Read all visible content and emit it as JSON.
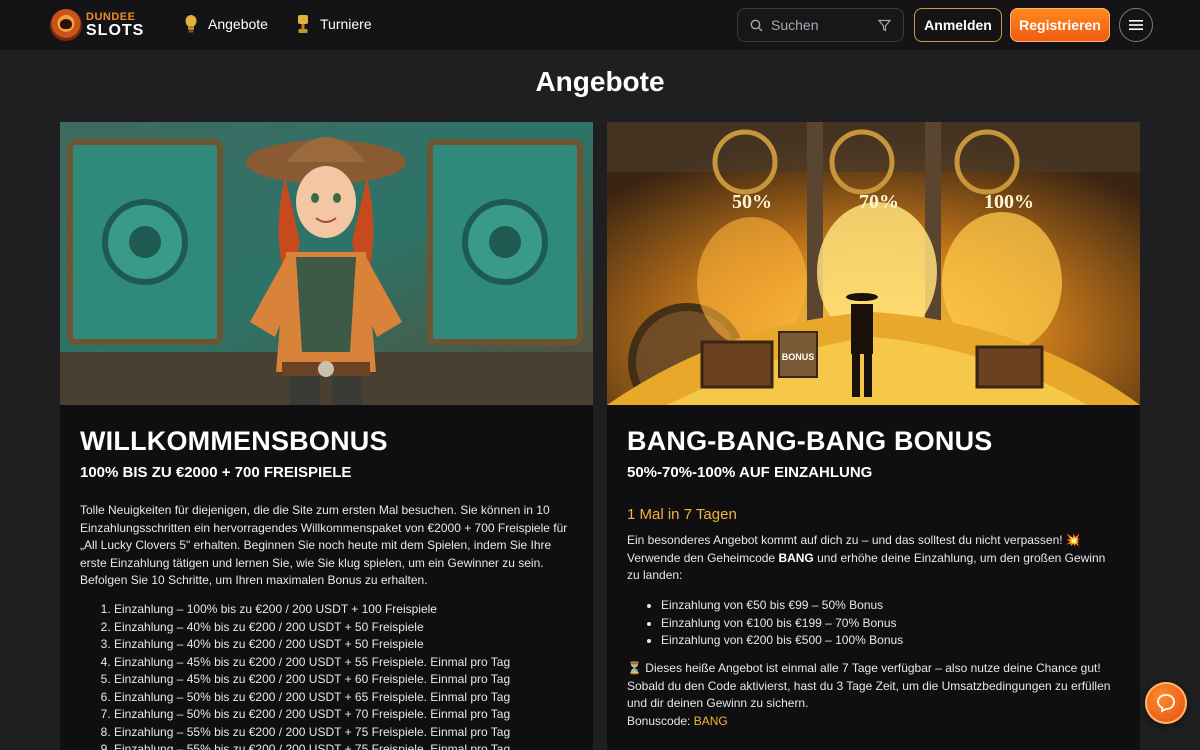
{
  "header": {
    "logo_line1": "DUNDEE",
    "logo_line2": "SLOTS",
    "nav": [
      {
        "label": "Angebote",
        "icon": "lightbulb-icon"
      },
      {
        "label": "Turniere",
        "icon": "trophy-icon"
      }
    ],
    "search_placeholder": "Suchen",
    "login_label": "Anmelden",
    "register_label": "Registrieren"
  },
  "page_title": "Angebote",
  "cards": [
    {
      "title": "WILLKOMMENSBONUS",
      "subtitle": "100% BIS ZU €2000 + 700 FREISPIELE",
      "intro": "Tolle Neuigkeiten für diejenigen, die die Site zum ersten Mal besuchen. Sie können in 10 Einzahlungsschritten ein hervorragendes Willkommenspaket von €2000 + 700 Freispiele für „All Lucky Clovers 5\" erhalten. Beginnen Sie noch heute mit dem Spielen, indem Sie Ihre erste Einzahlung tätigen und lernen Sie, wie Sie klug spielen, um ein Gewinner zu sein. Befolgen Sie 10 Schritte, um Ihren maximalen Bonus zu erhalten.",
      "steps": [
        "Einzahlung – 100% bis zu €200 / 200 USDT + 100 Freispiele",
        "Einzahlung – 40% bis zu €200 / 200 USDT + 50 Freispiele",
        "Einzahlung – 40% bis zu €200 / 200 USDT + 50 Freispiele",
        "Einzahlung – 45% bis zu €200 / 200 USDT + 55 Freispiele. Einmal pro Tag",
        "Einzahlung – 45% bis zu €200 / 200 USDT + 60 Freispiele. Einmal pro Tag",
        "Einzahlung – 50% bis zu €200 / 200 USDT + 65 Freispiele. Einmal pro Tag",
        "Einzahlung – 50% bis zu €200 / 200 USDT + 70 Freispiele. Einmal pro Tag",
        "Einzahlung – 55% bis zu €200 / 200 USDT + 75 Freispiele. Einmal pro Tag",
        "Einzahlung – 55% bis zu €200 / 200 USDT + 75 Freispiele. Einmal pro Tag"
      ]
    },
    {
      "title": "BANG-BANG-BANG BONUS",
      "subtitle": "50%-70%-100% AUF EINZAHLUNG",
      "frequency": "1 Mal in 7 Tagen",
      "intro_line1": "Ein besonderes Angebot kommt auf dich zu – und das solltest du nicht verpassen! 💥",
      "intro_line2_pre": "Verwende den Geheimcode ",
      "intro_code": "BANG",
      "intro_line2_post": " und erhöhe deine Einzahlung, um den großen Gewinn zu landen:",
      "tiers": [
        "Einzahlung von €50 bis €99 – 50% Bonus",
        "Einzahlung von €100 bis €199 – 70% Bonus",
        "Einzahlung von €200 bis €500 – 100% Bonus"
      ],
      "outro": "⏳ Dieses heiße Angebot ist einmal alle 7 Tage verfügbar – also nutze deine Chance gut! Sobald du den Code aktivierst, hast du 3 Tage Zeit, um die Umsatzbedingungen zu erfüllen und dir deinen Gewinn zu sichern.",
      "bonuscode_label": "Bonuscode: ",
      "bonuscode_value": "BANG",
      "image_labels": [
        "50%",
        "70%",
        "100%"
      ],
      "chest_label": "BONUS"
    }
  ],
  "colors": {
    "accent": "#ef5a12",
    "gold": "#f2b43a",
    "background": "#1f1f22",
    "card": "#0f0f12"
  }
}
